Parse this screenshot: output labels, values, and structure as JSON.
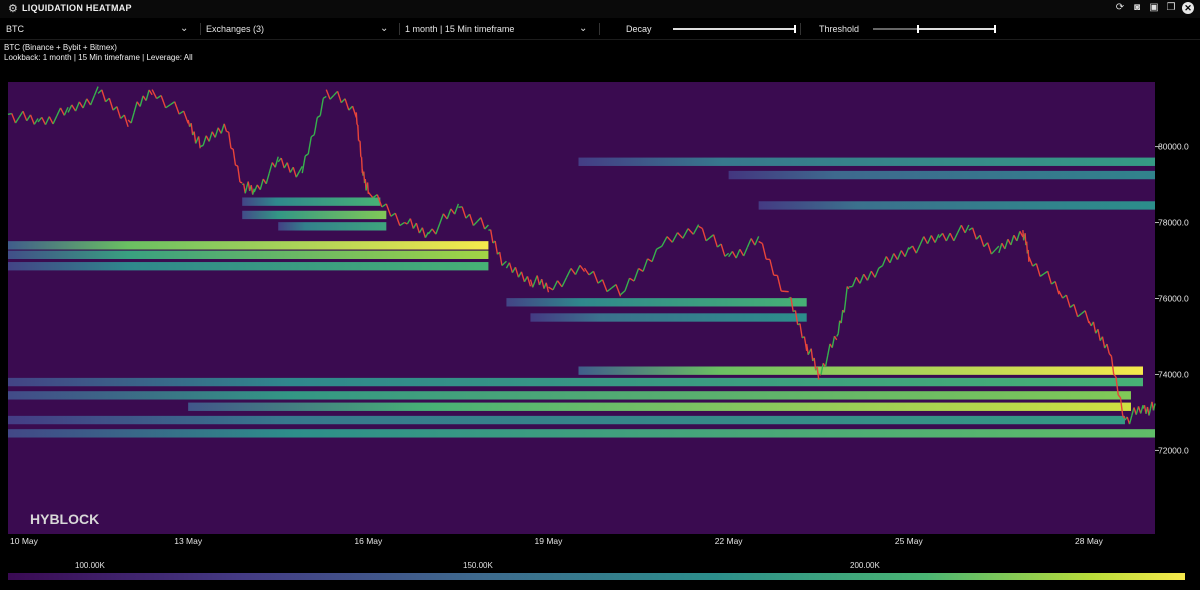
{
  "header": {
    "title": "LIQUIDATION HEATMAP",
    "icons": [
      "refresh-icon",
      "camera-icon",
      "save-icon",
      "copy-icon",
      "close-icon"
    ]
  },
  "controls": {
    "symbol": "BTC",
    "exchanges": "Exchanges  (3)",
    "timeframe": "1 month | 15 Min timeframe",
    "decay_label": "Decay",
    "decay_value": 1.0,
    "threshold_label": "Threshold",
    "threshold_range": [
      0.37,
      1.0
    ]
  },
  "info": {
    "line1": "BTC (Binance + Bybit + Bitmex)",
    "line2": "Lookback: 1 month | 15 Min timeframe | Leverage: All"
  },
  "watermark": "HYBLOCK",
  "chart_data": {
    "type": "heatmap",
    "x_ticks": [
      "10 May",
      "13 May",
      "16 May",
      "19 May",
      "22 May",
      "25 May",
      "28 May"
    ],
    "x_tick_days": [
      0,
      3,
      6,
      9,
      12,
      15,
      18
    ],
    "x_range_days": [
      0,
      19.1
    ],
    "y_ticks": [
      "80000.0",
      "78000.0",
      "76000.0",
      "74000.0",
      "72000.0"
    ],
    "y_tick_values": [
      80000,
      78000,
      76000,
      74000,
      72000
    ],
    "ylim": [
      69800,
      81700
    ],
    "colorscale": [
      "#3a0a53",
      "#443b84",
      "#3e6a8e",
      "#2c8e8b",
      "#4ab573",
      "#b8dc3a",
      "#f6e94c"
    ],
    "colorbar_ticks": [
      "100.00K",
      "150.00K",
      "200.00K"
    ],
    "background_color": "#3a0b50",
    "candle_up_color": "#37b24d",
    "candle_down_color": "#e8443a",
    "price_path": [
      [
        0.0,
        80850
      ],
      [
        0.5,
        80650
      ],
      [
        1.0,
        80900
      ],
      [
        1.5,
        81400
      ],
      [
        2.0,
        80700
      ],
      [
        2.4,
        81500
      ],
      [
        3.0,
        80700
      ],
      [
        3.2,
        80000
      ],
      [
        3.6,
        80600
      ],
      [
        3.9,
        79000
      ],
      [
        4.1,
        78800
      ],
      [
        4.5,
        79600
      ],
      [
        4.9,
        79300
      ],
      [
        5.3,
        81500
      ],
      [
        5.8,
        80900
      ],
      [
        5.9,
        79400
      ],
      [
        6.0,
        78800
      ],
      [
        6.6,
        78000
      ],
      [
        7.0,
        77700
      ],
      [
        7.5,
        78400
      ],
      [
        8.0,
        77800
      ],
      [
        8.3,
        76800
      ],
      [
        8.7,
        76500
      ],
      [
        9.0,
        76300
      ],
      [
        9.6,
        76800
      ],
      [
        10.2,
        76100
      ],
      [
        10.8,
        77300
      ],
      [
        11.5,
        77900
      ],
      [
        12.0,
        77100
      ],
      [
        12.5,
        77500
      ],
      [
        13.0,
        76000
      ],
      [
        13.3,
        74800
      ],
      [
        13.5,
        74000
      ],
      [
        13.8,
        75000
      ],
      [
        14.0,
        76300
      ],
      [
        14.5,
        76800
      ],
      [
        15.0,
        77300
      ],
      [
        15.5,
        77600
      ],
      [
        16.0,
        77800
      ],
      [
        16.5,
        77200
      ],
      [
        16.9,
        77800
      ],
      [
        17.0,
        77100
      ],
      [
        17.5,
        76200
      ],
      [
        18.0,
        75400
      ],
      [
        18.3,
        74800
      ],
      [
        18.6,
        72800
      ],
      [
        18.9,
        73100
      ],
      [
        19.1,
        73100
      ]
    ],
    "liquidation_bands": [
      {
        "price": 78550,
        "start": 3.9,
        "end": 6.2,
        "intensity": 0.6
      },
      {
        "price": 78200,
        "start": 3.9,
        "end": 6.3,
        "intensity": 0.7
      },
      {
        "price": 77900,
        "start": 4.5,
        "end": 6.3,
        "intensity": 0.55
      },
      {
        "price": 77400,
        "start": 0.0,
        "end": 8.0,
        "intensity": 0.95
      },
      {
        "price": 77150,
        "start": 0.0,
        "end": 8.0,
        "intensity": 0.75
      },
      {
        "price": 76850,
        "start": 0.0,
        "end": 8.0,
        "intensity": 0.6
      },
      {
        "price": 75900,
        "start": 8.3,
        "end": 13.3,
        "intensity": 0.6
      },
      {
        "price": 75500,
        "start": 8.7,
        "end": 13.3,
        "intensity": 0.45
      },
      {
        "price": 74100,
        "start": 9.5,
        "end": 18.9,
        "intensity": 0.95
      },
      {
        "price": 73800,
        "start": 0.0,
        "end": 18.9,
        "intensity": 0.6
      },
      {
        "price": 73450,
        "start": 0.0,
        "end": 18.7,
        "intensity": 0.7
      },
      {
        "price": 73150,
        "start": 3.0,
        "end": 18.7,
        "intensity": 0.85
      },
      {
        "price": 72800,
        "start": 0.0,
        "end": 18.6,
        "intensity": 0.5
      },
      {
        "price": 72450,
        "start": 0.0,
        "end": 19.1,
        "intensity": 0.65
      },
      {
        "price": 79600,
        "start": 9.5,
        "end": 19.1,
        "intensity": 0.5
      },
      {
        "price": 79250,
        "start": 12.0,
        "end": 19.1,
        "intensity": 0.4
      },
      {
        "price": 78450,
        "start": 12.5,
        "end": 19.1,
        "intensity": 0.45
      }
    ]
  }
}
